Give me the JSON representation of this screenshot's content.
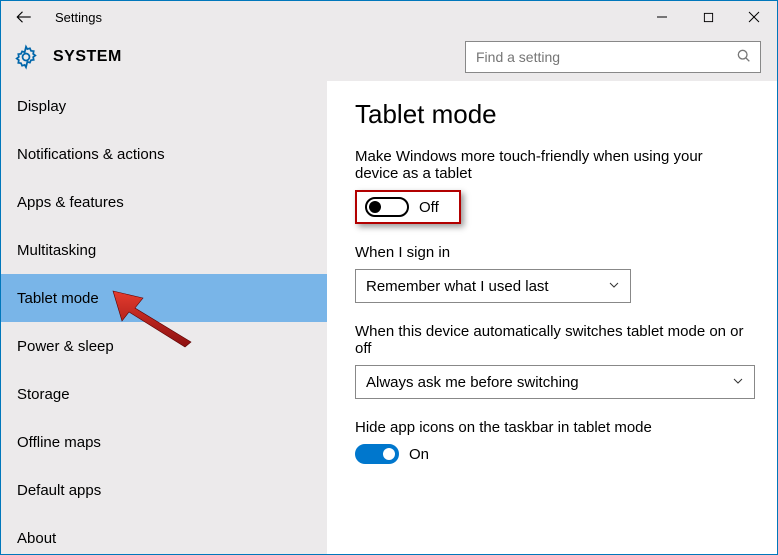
{
  "window": {
    "title": "Settings"
  },
  "category": "SYSTEM",
  "search": {
    "placeholder": "Find a setting"
  },
  "sidebar": {
    "items": [
      {
        "label": "Display"
      },
      {
        "label": "Notifications & actions"
      },
      {
        "label": "Apps & features"
      },
      {
        "label": "Multitasking"
      },
      {
        "label": "Tablet mode"
      },
      {
        "label": "Power & sleep"
      },
      {
        "label": "Storage"
      },
      {
        "label": "Offline maps"
      },
      {
        "label": "Default apps"
      },
      {
        "label": "About"
      }
    ],
    "selected_index": 4
  },
  "page": {
    "title": "Tablet mode",
    "touch_desc": "Make Windows more touch-friendly when using your device as a tablet",
    "touch_toggle_state": "Off",
    "signin_label": "When I sign in",
    "signin_value": "Remember what I used last",
    "switch_label": "When this device automatically switches tablet mode on or off",
    "switch_value": "Always ask me before switching",
    "hide_label": "Hide app icons on the taskbar in tablet mode",
    "hide_toggle_state": "On"
  }
}
